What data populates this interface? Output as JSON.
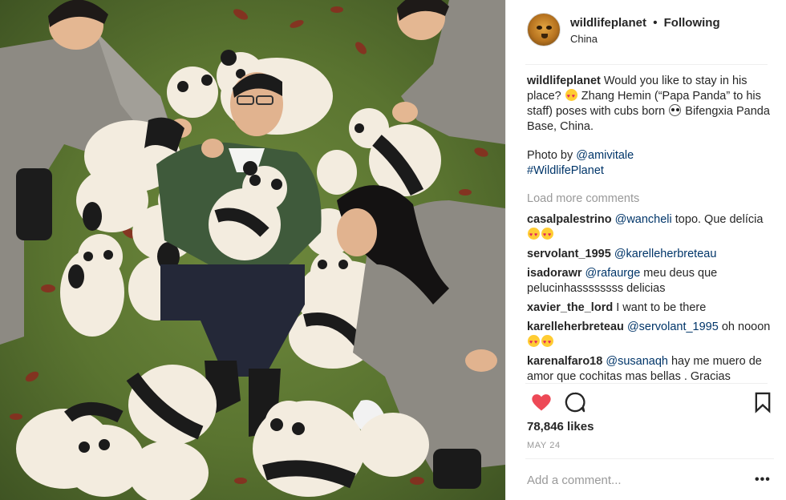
{
  "post": {
    "username": "wildlifeplanet",
    "separator": "•",
    "follow_status": "Following",
    "location": "China",
    "likes": "78,846 likes",
    "date": "MAY 24",
    "add_comment_placeholder": "Add a comment...",
    "more_glyph": "•••",
    "load_more": "Load more comments"
  },
  "caption": {
    "username": "wildlifeplanet",
    "line1_a": "Would you like to stay in his place?",
    "line1_b": "Zhang Hemin (“Papa Panda” to his staff) poses with cubs born",
    "line1_c": "Bifengxia Panda Base, China.",
    "photo_by": "Photo by",
    "photo_credit": "@amivitale",
    "hashtag": "#WildlifePlanet"
  },
  "comments": [
    {
      "user": "casalpalestrino",
      "mention": "@wancheli",
      "text": "topo. Que delícia",
      "emoji": "heart-eyes-x2"
    },
    {
      "user": "servolant_1995",
      "mention": "@karelleherbreteau",
      "text": "",
      "emoji": ""
    },
    {
      "user": "isadorawr",
      "mention": "@rafaurge",
      "text": "meu deus que pelucinhassssssss delicias",
      "emoji": ""
    },
    {
      "user": "xavier_the_lord",
      "mention": "",
      "text": "I want to be there",
      "emoji": ""
    },
    {
      "user": "karelleherbreteau",
      "mention": "@servolant_1995",
      "text": "oh nooon",
      "emoji": "heart-eyes-x2"
    },
    {
      "user": "karenalfaro18",
      "mention": "@susanaqh",
      "text": "hay me muero de amor que cochitas mas bellas . Gracias",
      "emoji": ""
    }
  ],
  "icons": {
    "like": "heart-icon",
    "comment": "comment-bubble-icon",
    "save": "bookmark-icon",
    "avatar": "tiger-avatar"
  },
  "colors": {
    "like_red": "#ed4956",
    "mention_blue": "#003569",
    "muted_gray": "#999999",
    "text": "#262626"
  }
}
